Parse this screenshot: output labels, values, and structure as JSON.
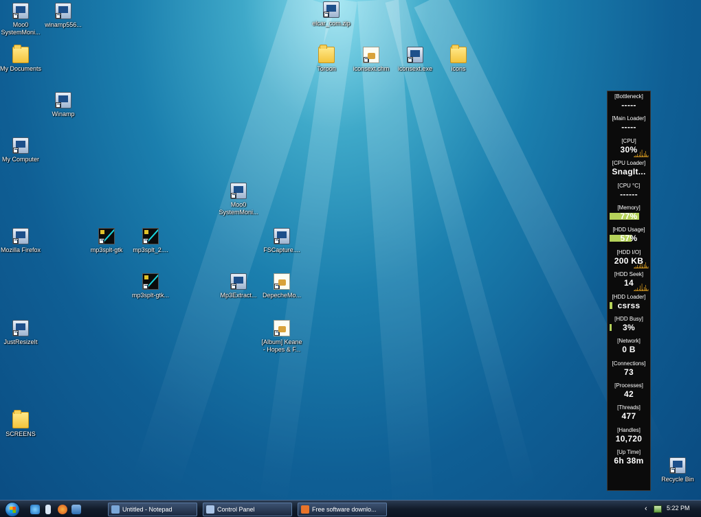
{
  "desktop": {
    "icons": [
      {
        "name": "moo0-systemmonitor-icon-1",
        "label": "Moo0\nSystemMoni...",
        "type": "prog"
      },
      {
        "name": "winamp-installer-icon",
        "label": "winamp556...",
        "type": "prog"
      },
      {
        "name": "archive-zip-icon",
        "label": "elcar_com.zip",
        "type": "prog"
      },
      {
        "name": "folder-icon",
        "label": "Toroon",
        "type": "folder"
      },
      {
        "name": "help-file-icon",
        "label": "iconsext.chm",
        "type": "doc"
      },
      {
        "name": "iconsext-exe-icon",
        "label": "iconsext.exe",
        "type": "prog"
      },
      {
        "name": "folder-icon",
        "label": "icons",
        "type": "folder"
      },
      {
        "name": "folder-icon",
        "label": "My Documents",
        "type": "folder"
      },
      {
        "name": "winamp-icon",
        "label": "Winamp",
        "type": "prog"
      },
      {
        "name": "my-computer-icon",
        "label": "My Computer",
        "type": "prog"
      },
      {
        "name": "moo0-systemmonitor-icon-2",
        "label": "Moo0\nSystemMoni...",
        "type": "prog"
      },
      {
        "name": "firefox-icon",
        "label": "Mozilla Firefox",
        "type": "prog"
      },
      {
        "name": "mp3splt-icon",
        "label": "mp3splt-gtk",
        "type": "mp3"
      },
      {
        "name": "mp3splt-icon",
        "label": "mp3splt_2....",
        "type": "mp3"
      },
      {
        "name": "fscapture-icon",
        "label": "FSCapture....",
        "type": "prog"
      },
      {
        "name": "mp3splt-icon",
        "label": "mp3splt-gtk...",
        "type": "mp3"
      },
      {
        "name": "mp3extract-icon",
        "label": "Mp3Extract...",
        "type": "prog"
      },
      {
        "name": "depechemode-file-icon",
        "label": "DepecheMo...",
        "type": "doc"
      },
      {
        "name": "justresizeit-icon",
        "label": "JustResizeIt",
        "type": "prog"
      },
      {
        "name": "album-file-icon",
        "label": "[Album] Keane\n- Hopes & F...",
        "type": "doc"
      },
      {
        "name": "folder-icon",
        "label": "SCREENS",
        "type": "folder"
      },
      {
        "name": "recycle-bin-icon",
        "label": "Recycle Bin",
        "type": "prog"
      }
    ]
  },
  "monitor": {
    "items": [
      {
        "label": "[Bottleneck]",
        "value": "-----",
        "bar": null,
        "spark": false
      },
      {
        "label": "[Main Loader]",
        "value": "-----",
        "bar": null,
        "spark": false
      },
      {
        "label": "[CPU]",
        "value": "30%",
        "bar": null,
        "spark": true
      },
      {
        "label": "[CPU Loader]",
        "value": "SnagIt...",
        "bar": null,
        "spark": false
      },
      {
        "label": "[CPU °C]",
        "value": "------",
        "bar": null,
        "spark": false
      },
      {
        "label": "[Memory]",
        "value": "77%",
        "bar": 0.77,
        "spark": false
      },
      {
        "label": "[HDD Usage]",
        "value": "57%",
        "bar": 0.57,
        "spark": false
      },
      {
        "label": "[HDD I/O]",
        "value": "200 KB",
        "bar": null,
        "spark": true
      },
      {
        "label": "[HDD Seek]",
        "value": "14",
        "bar": null,
        "spark": true
      },
      {
        "label": "[HDD Loader]",
        "value": "csrss",
        "bar": 0.08,
        "spark": false
      },
      {
        "label": "[HDD Busy]",
        "value": "3%",
        "bar": 0.03,
        "spark": false
      },
      {
        "label": "[Network]",
        "value": "0 B",
        "bar": null,
        "spark": false
      },
      {
        "label": "[Connections]",
        "value": "73",
        "bar": null,
        "spark": false
      },
      {
        "label": "[Processes]",
        "value": "42",
        "bar": null,
        "spark": false
      },
      {
        "label": "[Threads]",
        "value": "477",
        "bar": null,
        "spark": false
      },
      {
        "label": "[Handles]",
        "value": "10,720",
        "bar": null,
        "spark": false
      },
      {
        "label": "[Up Time]",
        "value": "6h 38m",
        "bar": null,
        "spark": false
      }
    ]
  },
  "taskbar": {
    "tasks": [
      {
        "label": "Untitled - Notepad",
        "color": "#7aa7d8"
      },
      {
        "label": "Control Panel",
        "color": "#a9c4e6"
      },
      {
        "label": "Free software downlo...",
        "color": "#e8742a"
      }
    ],
    "clock": "5:22 PM"
  }
}
